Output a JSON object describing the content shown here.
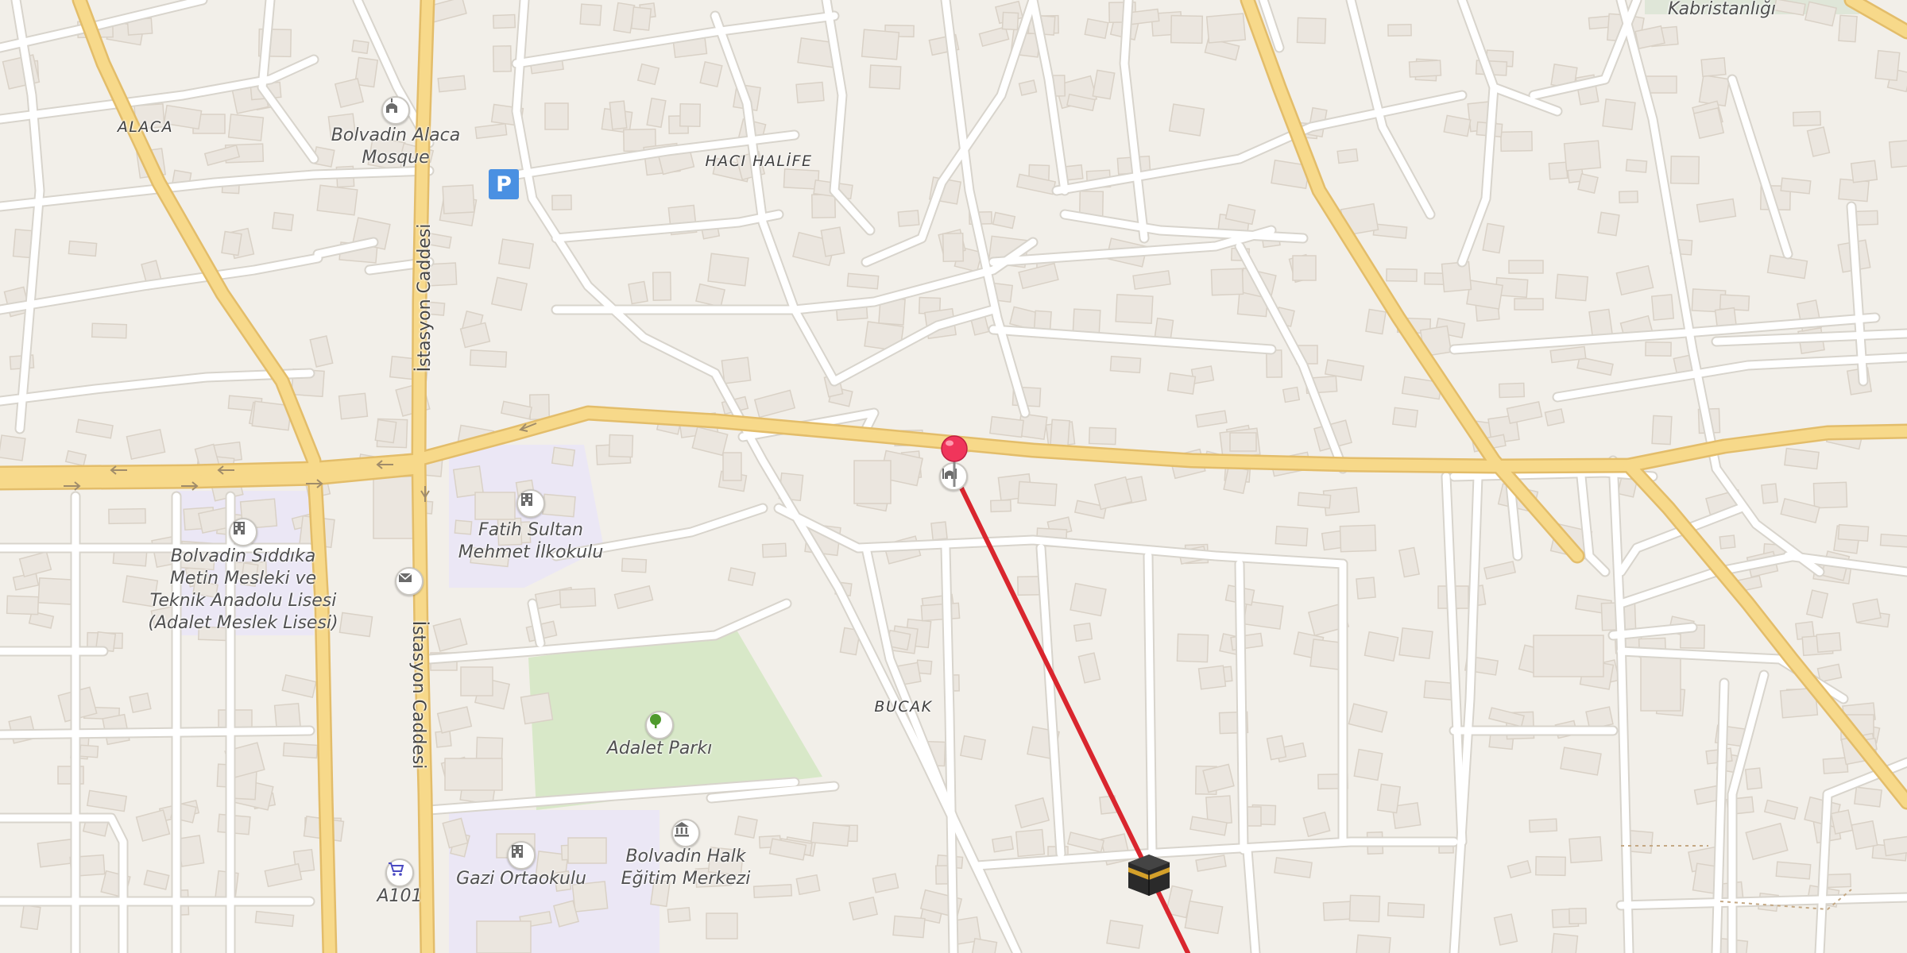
{
  "map": {
    "colors": {
      "background": "#f2efe9",
      "building": "#ebe6df",
      "building_edge": "#d9d1c6",
      "minor_road": "#ffffff",
      "minor_road_casing": "#d8d4cc",
      "major_road": "#f7d98a",
      "major_road_casing": "#e3bd6a",
      "park": "#d8e8c8",
      "school_area": "#ebe7f5",
      "route_line": "#d9262e",
      "pin": "#f0355b"
    },
    "neighborhoods": {
      "alaca": "ALACA",
      "haci_halife": "HACI HALİFE",
      "bucak": "BUCAK"
    },
    "streets": {
      "istasyon_north": "İstasyon Caddesi",
      "istasyon_south": "İstasyon Caddesi"
    },
    "places": {
      "kabristan": "Kabristanlığı",
      "mosque_line1": "Bolvadin Alaca",
      "mosque_line2": "Mosque",
      "fatih_line1": "Fatih Sultan",
      "fatih_line2": "Mehmet İlkokulu",
      "siddika_line1": "Bolvadin Sıddıka",
      "siddika_line2": "Metin Mesleki ve",
      "siddika_line3": "Teknik Anadolu Lisesi",
      "siddika_line4": "(Adalet Meslek Lisesi)",
      "park": "Adalet Parkı",
      "halk_line1": "Bolvadin Halk",
      "halk_line2": "Eğitim Merkezi",
      "gazi": "Gazi Ortaokulu",
      "a101": "A101",
      "parking": "P"
    },
    "icons": {
      "mosque": "mosque-icon",
      "school": "school-icon",
      "post": "post-office-icon",
      "park": "tree-icon",
      "community": "museum-icon",
      "shop": "shopping-cart-icon",
      "parking": "parking-icon",
      "pin": "location-pin-icon",
      "kaaba": "kaaba-icon"
    }
  }
}
